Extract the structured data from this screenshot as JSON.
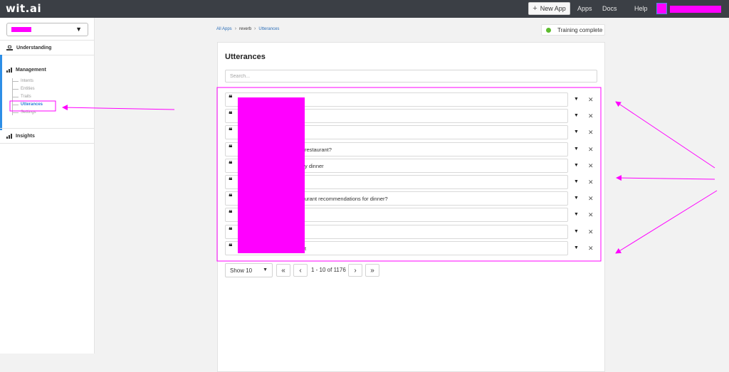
{
  "topbar": {
    "logo": "wit.ai",
    "new_app": "New App",
    "new_app_icon": "plus-icon",
    "links": [
      "Apps",
      "Docs",
      "Help"
    ]
  },
  "sidebar": {
    "understanding": "Understanding",
    "management": "Management",
    "sub_items": [
      "Intents",
      "Entities",
      "Traits",
      "Utterances",
      "Settings"
    ],
    "active_item": "Utterances",
    "insights": "Insights"
  },
  "breadcrumb": {
    "all_apps": "All Apps",
    "app": "reverb",
    "current": "Utterances",
    "sep": "›"
  },
  "status": {
    "label": "Training complete",
    "color": "#5dbb2e"
  },
  "utterances": {
    "title": "Utterances",
    "search_placeholder": "Search...",
    "rows": [
      "",
      "",
      "",
      "restaurant?",
      "y dinner",
      "",
      "urant recommendations for dinner?",
      "",
      "",
      "t"
    ],
    "quote_glyph": "❝",
    "caret_glyph": "▼",
    "remove_glyph": "✕"
  },
  "pagination": {
    "show": "Show 10",
    "range": "1 - 10 of 1176",
    "first": "«",
    "prev": "‹",
    "next": "›",
    "last": "»"
  },
  "colors": {
    "topbar": "#3b3f45",
    "accent": "#2d8ee6",
    "annotation": "#ff00ff"
  }
}
